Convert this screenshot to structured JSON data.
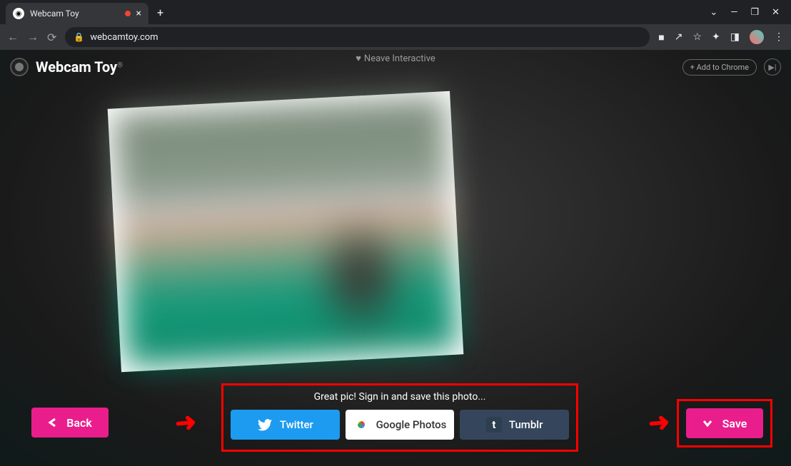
{
  "browser": {
    "tab_title": "Webcam Toy",
    "url": "webcamtoy.com"
  },
  "header": {
    "logo": "Webcam Toy",
    "neave_text": "Neave Interactive",
    "add_chrome": "+ Add to Chrome"
  },
  "share": {
    "message": "Great pic! Sign in and save this photo...",
    "twitter": "Twitter",
    "gphotos": "Google Photos",
    "tumblr": "Tumblr"
  },
  "buttons": {
    "back": "Back",
    "save": "Save"
  }
}
